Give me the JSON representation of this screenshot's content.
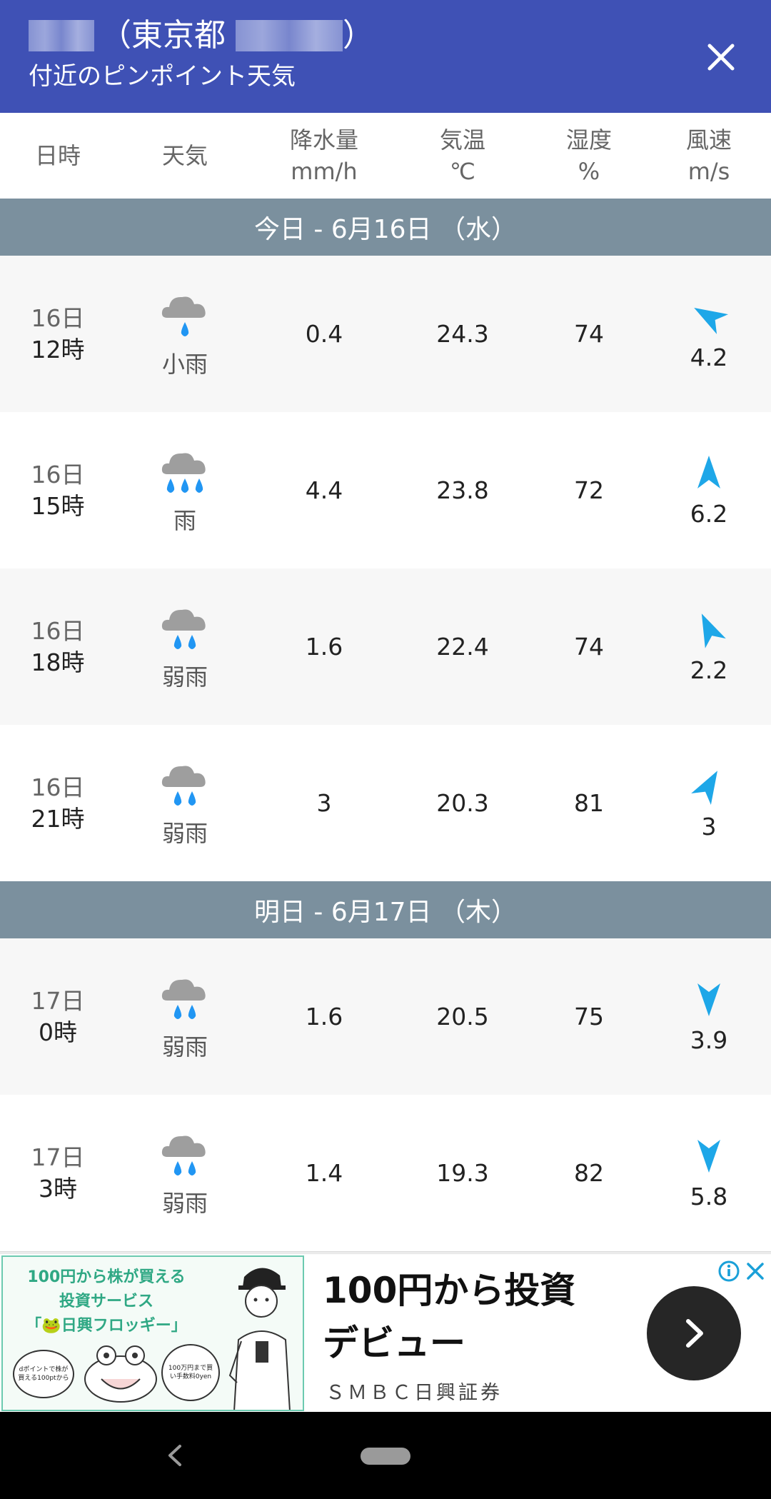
{
  "header": {
    "location_prefix": "（東京都",
    "location_suffix": "）",
    "subtitle": "付近のピンポイント天気"
  },
  "columns": [
    {
      "name": "日時",
      "unit": ""
    },
    {
      "name": "天気",
      "unit": ""
    },
    {
      "name": "降水量",
      "unit": "mm/h"
    },
    {
      "name": "気温",
      "unit": "℃"
    },
    {
      "name": "湿度",
      "unit": "%"
    },
    {
      "name": "風速",
      "unit": "m/s"
    }
  ],
  "sections": [
    {
      "label": "今日 - 6月16日 （水）",
      "rows": [
        {
          "day": "16日",
          "hour": "12時",
          "icon": "light-rain-icon",
          "weather": "小雨",
          "drops": 1,
          "precip": "0.4",
          "temp": "24.3",
          "humidity": "74",
          "wind_dir_deg": 300,
          "wind_speed": "4.2"
        },
        {
          "day": "16日",
          "hour": "15時",
          "icon": "rain-icon",
          "weather": "雨",
          "drops": 3,
          "precip": "4.4",
          "temp": "23.8",
          "humidity": "72",
          "wind_dir_deg": 0,
          "wind_speed": "6.2"
        },
        {
          "day": "16日",
          "hour": "18時",
          "icon": "weak-rain-icon",
          "weather": "弱雨",
          "drops": 2,
          "precip": "1.6",
          "temp": "22.4",
          "humidity": "74",
          "wind_dir_deg": 335,
          "wind_speed": "2.2"
        },
        {
          "day": "16日",
          "hour": "21時",
          "icon": "weak-rain-icon",
          "weather": "弱雨",
          "drops": 2,
          "precip": "3",
          "temp": "20.3",
          "humidity": "81",
          "wind_dir_deg": 30,
          "wind_speed": "3"
        }
      ]
    },
    {
      "label": "明日 - 6月17日 （木）",
      "rows": [
        {
          "day": "17日",
          "hour": "0時",
          "icon": "weak-rain-icon",
          "weather": "弱雨",
          "drops": 2,
          "precip": "1.6",
          "temp": "20.5",
          "humidity": "75",
          "wind_dir_deg": 180,
          "wind_speed": "3.9"
        },
        {
          "day": "17日",
          "hour": "3時",
          "icon": "weak-rain-icon",
          "weather": "弱雨",
          "drops": 2,
          "precip": "1.4",
          "temp": "19.3",
          "humidity": "82",
          "wind_dir_deg": 180,
          "wind_speed": "5.8"
        }
      ]
    }
  ],
  "ad": {
    "image_line1": "100円から株が買える",
    "image_line2": "投資サービス",
    "image_line3": "「🐸日興フロッギー」",
    "image_note_left": "dポイントで株が買える100ptから",
    "image_note_right": "100万円まで買い手数料0yen",
    "title_line1": "100円から投資",
    "title_line2": "デビュー",
    "advertiser": "ＳＭＢＣ日興証券"
  },
  "colors": {
    "header": "#3f51b5",
    "section": "#7b909e",
    "rain_drop": "#2196f3",
    "cloud": "#9e9e9e",
    "wind_arrow": "#1ea7e8"
  }
}
